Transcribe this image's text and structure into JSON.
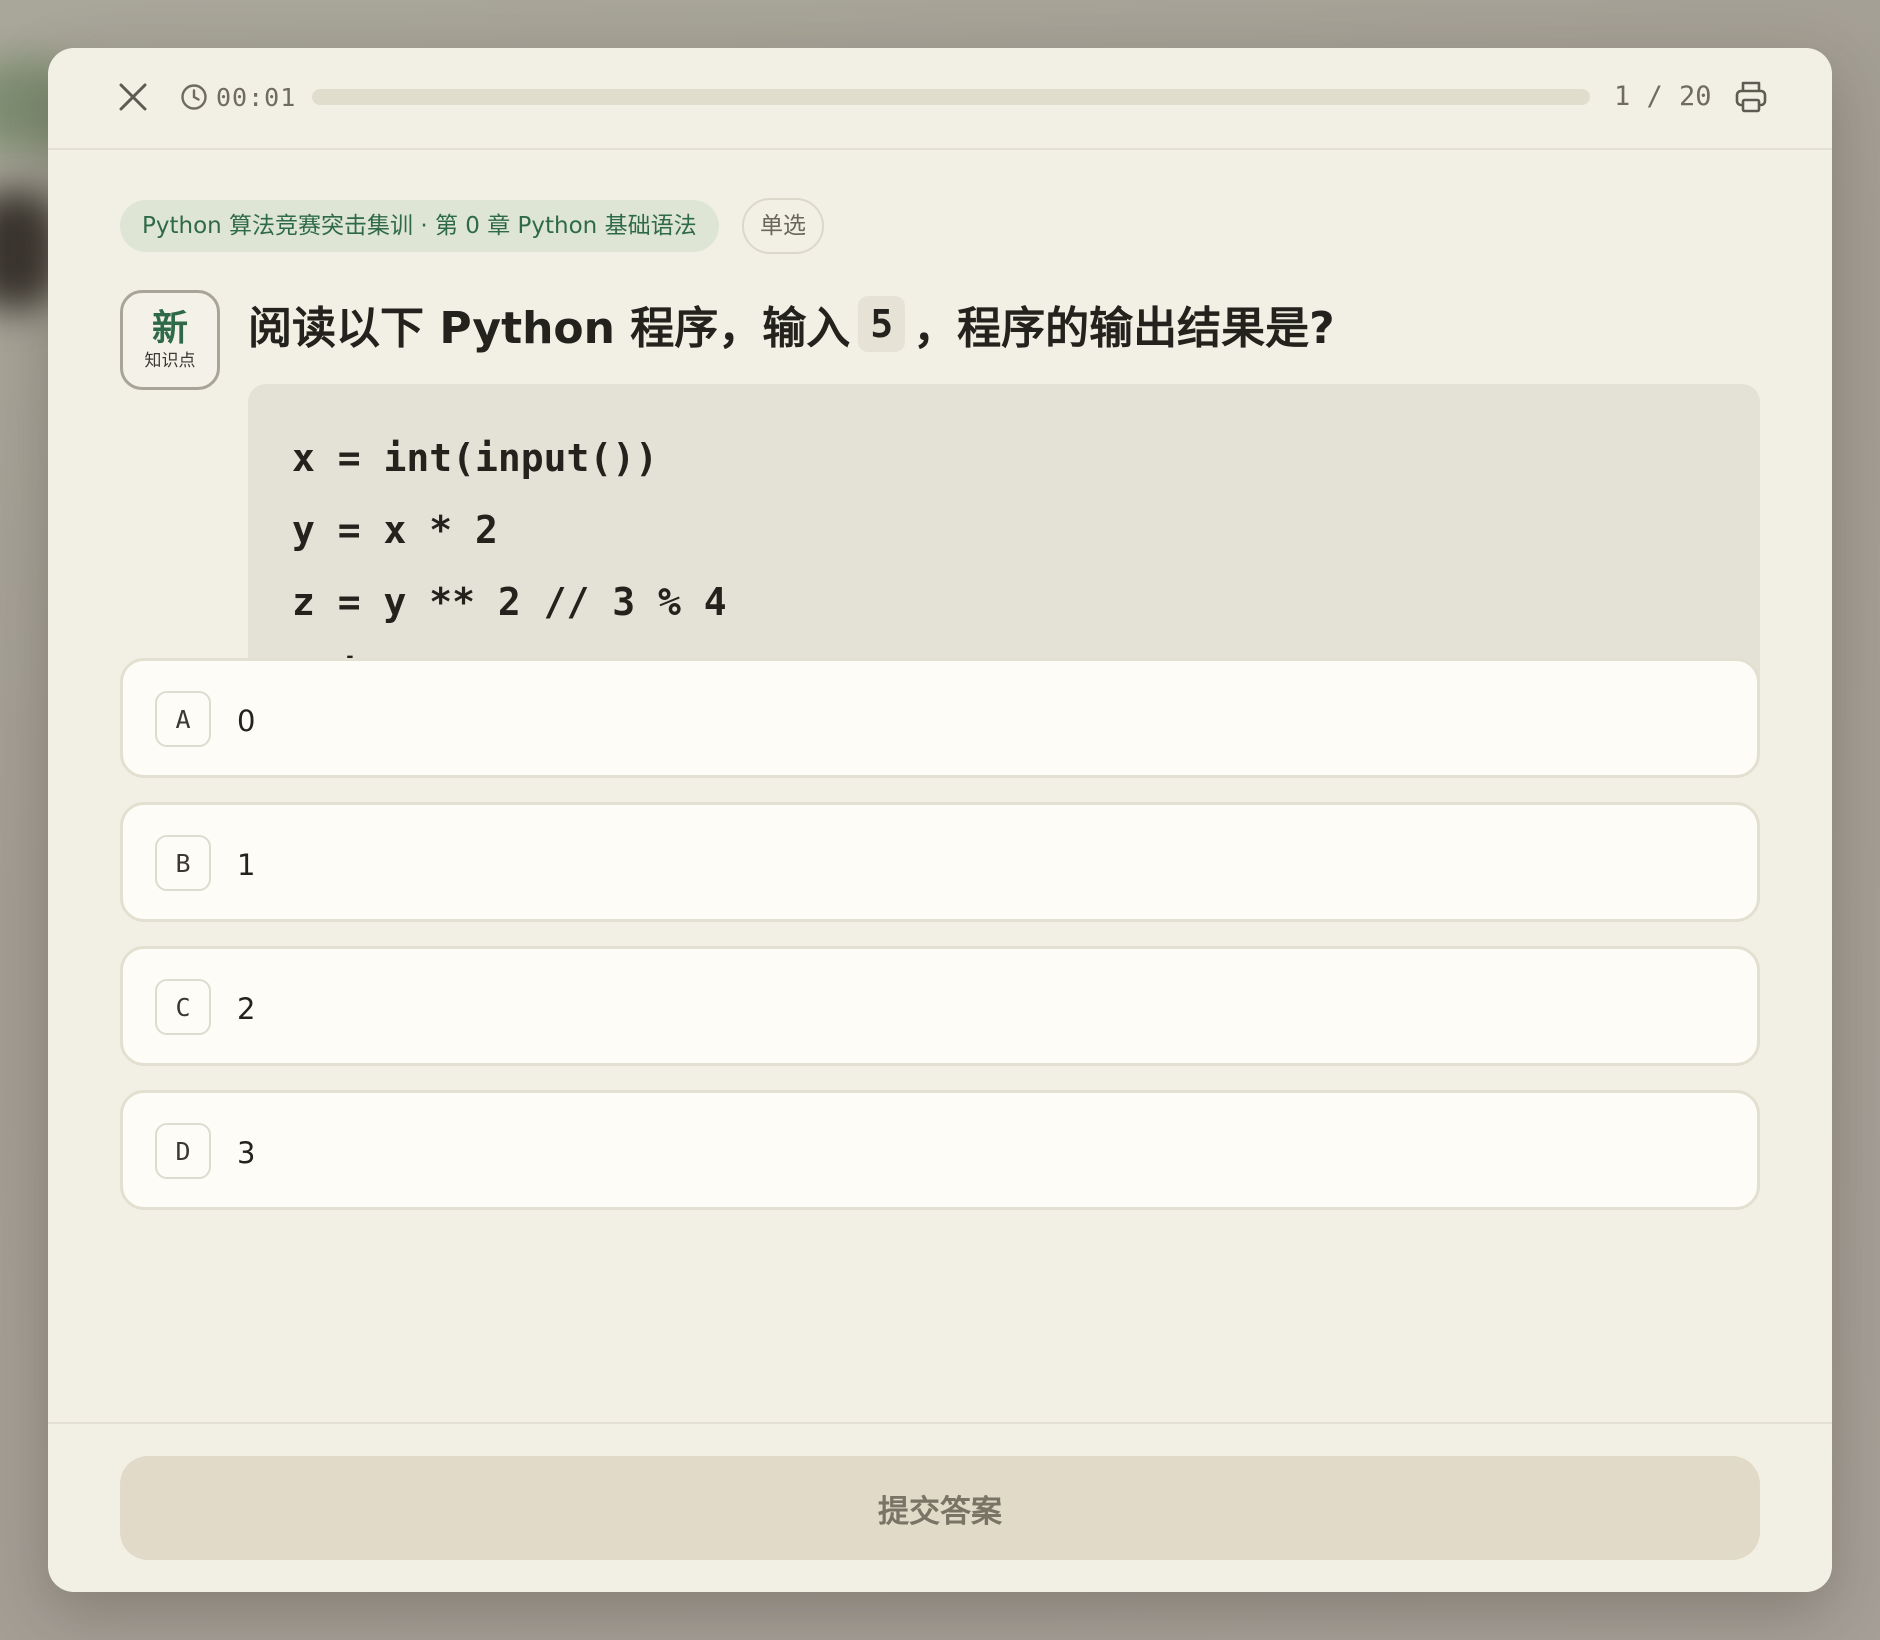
{
  "topbar": {
    "timer": "00:01",
    "progress_fraction": 0.0,
    "counter": "1 / 20"
  },
  "tags": {
    "course": "Python 算法竞赛突击集训 · 第 0 章 Python 基础语法",
    "type": "单选"
  },
  "badge": {
    "main": "新",
    "sub": "知识点"
  },
  "question": {
    "before": "阅读以下 Python 程序，输入",
    "input_value": "5",
    "after": "，程序的输出结果是?"
  },
  "code": {
    "lines": [
      "x = int(input())",
      "y = x * 2",
      "z = y ** 2 // 3 % 4",
      "print(z)"
    ]
  },
  "options": [
    {
      "letter": "A",
      "text": "0"
    },
    {
      "letter": "B",
      "text": "1"
    },
    {
      "letter": "C",
      "text": "2"
    },
    {
      "letter": "D",
      "text": "3"
    }
  ],
  "footer": {
    "submit_label": "提交答案"
  },
  "colors": {
    "accent_green": "#2f6a48",
    "panel_bg": "#f2f0e5",
    "submit_bg": "#e1dac8"
  }
}
